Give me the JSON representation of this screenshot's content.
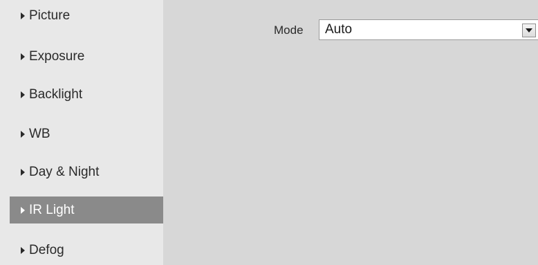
{
  "sidebar": {
    "items": [
      {
        "label": "Picture",
        "active": false
      },
      {
        "label": "Exposure",
        "active": false
      },
      {
        "label": "Backlight",
        "active": false
      },
      {
        "label": "WB",
        "active": false
      },
      {
        "label": "Day & Night",
        "active": false
      },
      {
        "label": "IR Light",
        "active": true
      },
      {
        "label": "Defog",
        "active": false
      }
    ]
  },
  "settings": {
    "mode_label": "Mode",
    "mode_value": "Auto"
  },
  "icons": {
    "nav_arrow": "triangle-right-icon",
    "dropdown": "chevron-down-icon"
  },
  "colors": {
    "page_bg": "#d7d7d7",
    "sidebar_bg": "#e8e8e8",
    "active_item_bg": "#8a8a8a",
    "active_item_text": "#ffffff"
  }
}
